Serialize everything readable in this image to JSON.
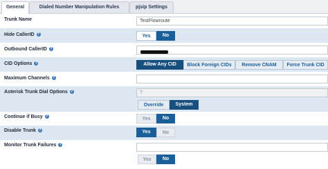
{
  "tabs": [
    "General",
    "Dialed Number Manipulation Rules",
    "pjsip Settings"
  ],
  "fields": {
    "trunk_name": {
      "label": "Trunk Name",
      "value": "TestFlowroute"
    },
    "hide_callerid": {
      "label": "Hide CallerID",
      "yes": "Yes",
      "no": "No",
      "selected": "No"
    },
    "outbound_callerid": {
      "label": "Outbound CallerID",
      "value": ""
    },
    "cid_options": {
      "label": "CID Options",
      "options": [
        "Allow Any CID",
        "Block Foreign CIDs",
        "Remove CNAM",
        "Force Trunk CID"
      ],
      "selected": "Allow Any CID"
    },
    "max_channels": {
      "label": "Maximum Channels",
      "value": ""
    },
    "dial_options": {
      "label": "Asterisk Trunk Dial Options",
      "value": "T",
      "override": "Override",
      "system": "System",
      "selected": "System"
    },
    "continue_busy": {
      "label": "Continue if Busy",
      "yes": "Yes",
      "no": "No",
      "selected": "No"
    },
    "disable_trunk": {
      "label": "Disable Trunk",
      "yes": "Yes",
      "no": "No",
      "selected": "Yes"
    },
    "monitor_failures": {
      "label": "Monitor Trunk Failures",
      "value": "",
      "yes": "Yes",
      "no": "No",
      "selected": "No"
    }
  },
  "help_glyph": "?",
  "colors": {
    "accent": "#1b5f9a",
    "row_alt": "#dde7f1"
  }
}
